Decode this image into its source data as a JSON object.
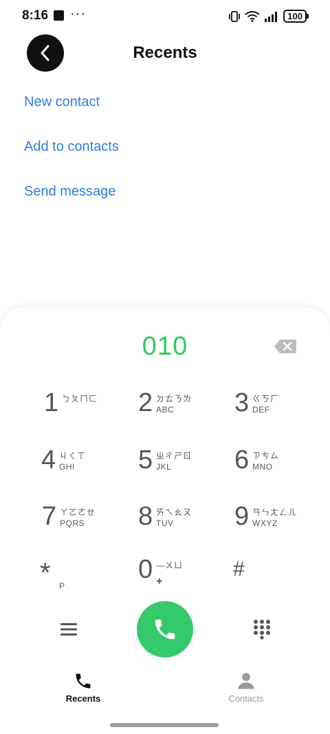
{
  "status_bar": {
    "time": "8:16",
    "dots": "···",
    "battery": "100"
  },
  "header": {
    "title": "Recents",
    "back_icon": "chevron-left-icon"
  },
  "actions": [
    {
      "label": "New contact"
    },
    {
      "label": "Add to contacts"
    },
    {
      "label": "Send message"
    }
  ],
  "dialer": {
    "number": "010",
    "keys": [
      {
        "digit": "1",
        "zhuyin": "ㄅㄆㄇㄈ",
        "letters": ""
      },
      {
        "digit": "2",
        "zhuyin": "ㄉㄊㄋㄌ",
        "letters": "ABC"
      },
      {
        "digit": "3",
        "zhuyin": "ㄍㄎㄏ",
        "letters": "DEF"
      },
      {
        "digit": "4",
        "zhuyin": "ㄐㄑㄒ",
        "letters": "GHI"
      },
      {
        "digit": "5",
        "zhuyin": "ㄓㄔㄕㄖ",
        "letters": "JKL"
      },
      {
        "digit": "6",
        "zhuyin": "ㄗㄘㄙ",
        "letters": "MNO"
      },
      {
        "digit": "7",
        "zhuyin": "ㄚㄛㄜㄝ",
        "letters": "PQRS"
      },
      {
        "digit": "8",
        "zhuyin": "ㄞㄟㄠㄡ",
        "letters": "TUV"
      },
      {
        "digit": "9",
        "zhuyin": "ㄢㄣㄤㄥㄦ",
        "letters": "WXYZ"
      },
      {
        "digit": "*",
        "zhuyin": "",
        "letters": "P"
      },
      {
        "digit": "0",
        "zhuyin": "—ㄨㄩ",
        "letters": "+"
      },
      {
        "digit": "#",
        "zhuyin": "",
        "letters": ""
      }
    ]
  },
  "tabs": [
    {
      "label": "Recents",
      "icon": "phone-icon",
      "active": true
    },
    {
      "label": "Contacts",
      "icon": "person-icon",
      "active": false
    }
  ],
  "colors": {
    "accent_blue": "#2b7fe0",
    "dial_green": "#2fca5f",
    "call_button": "#34c96b"
  }
}
